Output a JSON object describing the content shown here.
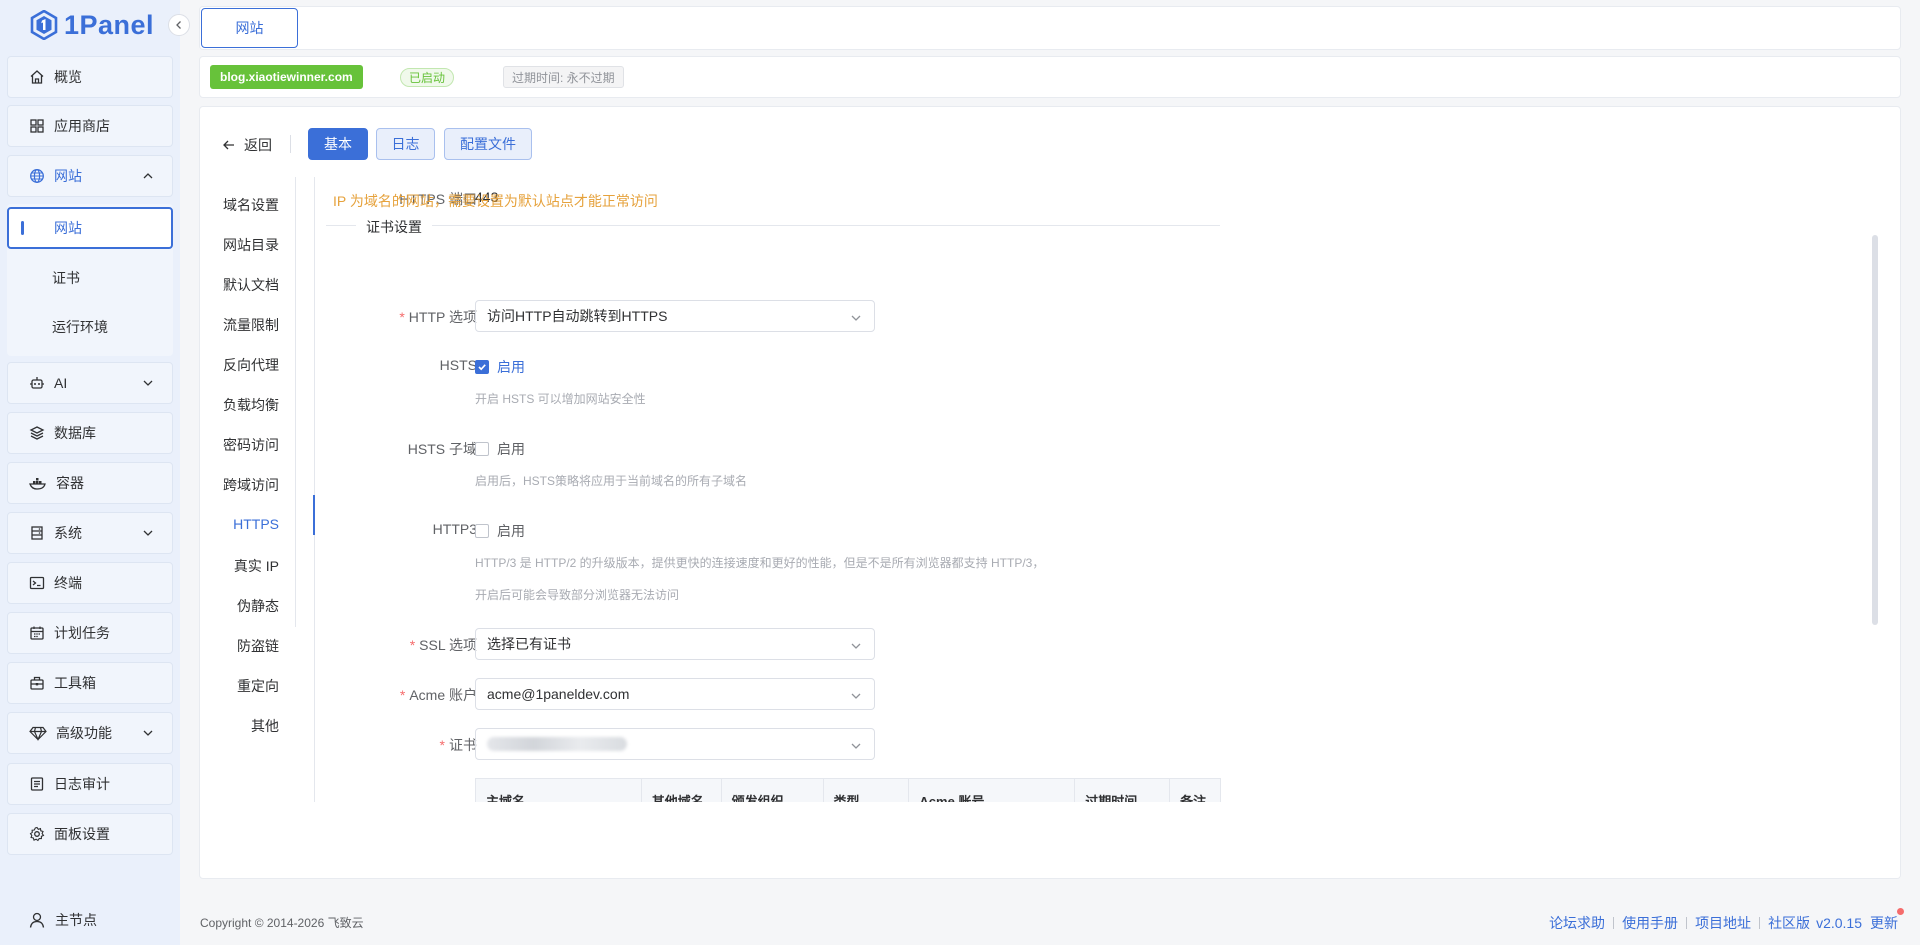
{
  "brand": {
    "name": "1Panel"
  },
  "sidebar": {
    "items": [
      {
        "label": "概览",
        "icon": "home-icon"
      },
      {
        "label": "应用商店",
        "icon": "apps-grid-icon"
      },
      {
        "label": "网站",
        "icon": "globe-icon"
      },
      {
        "label": "AI",
        "icon": "robot-icon"
      },
      {
        "label": "数据库",
        "icon": "database-layers-icon"
      },
      {
        "label": "容器",
        "icon": "container-whale-icon"
      },
      {
        "label": "系统",
        "icon": "server-icon"
      },
      {
        "label": "终端",
        "icon": "terminal-icon"
      },
      {
        "label": "计划任务",
        "icon": "calendar-icon"
      },
      {
        "label": "工具箱",
        "icon": "toolbox-icon"
      },
      {
        "label": "高级功能",
        "icon": "diamond-icon"
      },
      {
        "label": "日志审计",
        "icon": "log-icon"
      },
      {
        "label": "面板设置",
        "icon": "gear-icon"
      }
    ],
    "website_sub": [
      "网站",
      "证书",
      "运行环境"
    ],
    "node_label": "主节点"
  },
  "top_tab": {
    "label": "网站"
  },
  "site": {
    "domain": "blog.xiaotiewinner.com",
    "status": "已启动",
    "expire": "过期时间: 永不过期"
  },
  "actions": {
    "back": "返回",
    "basic": "基本",
    "log": "日志",
    "config": "配置文件"
  },
  "config_nav": [
    "域名设置",
    "网站目录",
    "默认文档",
    "流量限制",
    "反向代理",
    "负载均衡",
    "密码访问",
    "跨域访问",
    "HTTPS",
    "真实 IP",
    "伪静态",
    "防盗链",
    "重定向",
    "其他"
  ],
  "form": {
    "https_port_label": "HTTPS 端口",
    "https_port_value": "443",
    "warning": "IP 为域名的网站，需要设置为默认站点才能正常访问",
    "section_title": "证书设置",
    "http_option_label": "HTTP 选项",
    "http_option_value": "访问HTTP自动跳转到HTTPS",
    "hsts_label": "HSTS",
    "hsts_check": "启用",
    "hsts_checked": true,
    "hsts_hint": "开启 HSTS 可以增加网站安全性",
    "hsts_sub_label": "HSTS 子域",
    "hsts_sub_check": "启用",
    "hsts_sub_checked": false,
    "hsts_sub_hint": "启用后，HSTS策略将应用于当前域名的所有子域名",
    "http3_label": "HTTP3",
    "http3_check": "启用",
    "http3_checked": false,
    "http3_hint1": "HTTP/3 是 HTTP/2 的升级版本，提供更快的连接速度和更好的性能，但是不是所有浏览器都支持 HTTP/3，",
    "http3_hint2": "开启后可能会导致部分浏览器无法访问",
    "ssl_label": "SSL 选项",
    "ssl_value": "选择已有证书",
    "acme_label": "Acme 账户",
    "acme_value": "acme@1paneldev.com",
    "cert_label": "证书"
  },
  "cert_table": {
    "columns": [
      "主域名",
      "其他域名",
      "颁发组织",
      "类型",
      "Acme 账号",
      "过期时间",
      "备注"
    ]
  },
  "footer": {
    "copyright": "Copyright © 2014-2026 飞致云",
    "links": [
      "论坛求助",
      "使用手册",
      "项目地址",
      "社区版"
    ],
    "version": "v2.0.15",
    "update": "更新"
  },
  "colors": {
    "accent": "#3b6fd8",
    "success": "#67c23a",
    "warning": "#e6a23c",
    "required": "#f56c6c"
  }
}
